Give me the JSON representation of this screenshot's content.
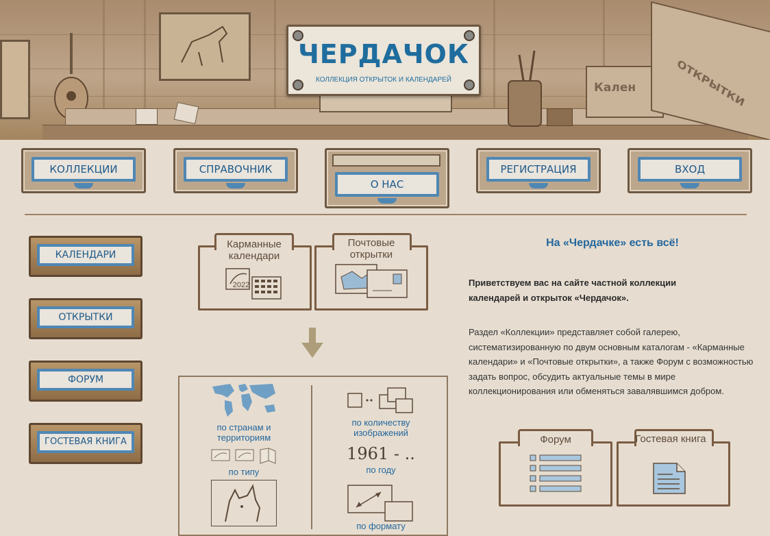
{
  "header": {
    "logo_title": "ЧЕРДАЧОК",
    "logo_subtitle": "КОЛЛЕКЦИЯ ОТКРЫТОК И КАЛЕНДАРЕЙ",
    "box_label_1": "Кален",
    "box_label_2": "ОТКРЫТКИ"
  },
  "top_nav": [
    {
      "label": "КОЛЛЕКЦИИ",
      "active": false
    },
    {
      "label": "СПРАВОЧНИК",
      "active": false
    },
    {
      "label": "О НАС",
      "active": true
    },
    {
      "label": "РЕГИСТРАЦИЯ",
      "active": false
    },
    {
      "label": "ВХОД",
      "active": false
    }
  ],
  "side_nav": [
    {
      "label": "КАЛЕНДАРИ"
    },
    {
      "label": "ОТКРЫТКИ"
    },
    {
      "label": "ФОРУМ"
    },
    {
      "label": "ГОСТЕВАЯ КНИГА"
    }
  ],
  "folders": {
    "pocket_calendars": "Карманные календари",
    "postcards": "Почтовые открытки",
    "calendar_year": "2022",
    "forum": "Форум",
    "guestbook": "Гостевая книга"
  },
  "catalog": {
    "by_country": "по странам и территориям",
    "by_type": "по типу",
    "by_count": "по количеству изображений",
    "year_range": "1961 - ..",
    "by_year": "по году",
    "by_format": "по формату"
  },
  "content": {
    "heading": "На «Чердачке» есть всё!",
    "intro": "Приветствуем вас на сайте частной коллекции календарей и открыток «Чердачок».",
    "paragraph": "Раздел «Коллекции» представляет собой галерею, систематизированную по двум основным каталогам - «Карманные календари» и «Почтовые открытки», а также Форум с возможностью задать вопрос, обсудить актуальные темы в мире коллекционирования или обменяться завалявшимся добром."
  },
  "colors": {
    "brand_blue": "#24679d",
    "wood": "#7a5c43",
    "paper": "#e6ddd0"
  }
}
